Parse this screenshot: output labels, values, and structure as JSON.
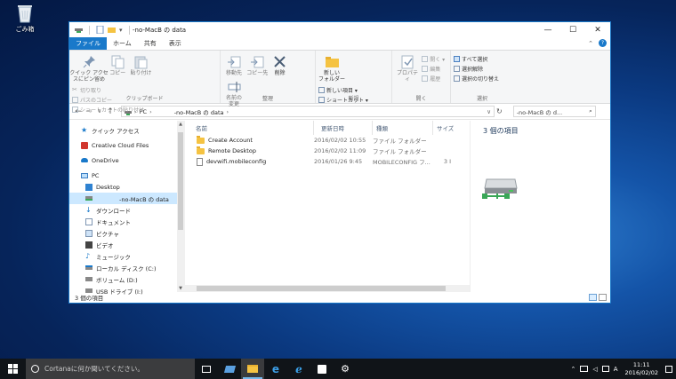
{
  "desktop": {
    "recycle_bin_label": "ごみ箱"
  },
  "window": {
    "title": "-no-MacB の data",
    "controls": {
      "minimize": "—",
      "maximize": "☐",
      "close": "✕"
    },
    "tabs": [
      {
        "label": "ファイル"
      },
      {
        "label": "ホーム"
      },
      {
        "label": "共有"
      },
      {
        "label": "表示"
      }
    ],
    "ribbon": {
      "clipboard": {
        "group_name": "クリップボード",
        "pin_label": "クイック アクセ\nスにピン留め",
        "copy_label": "コピー",
        "paste_label": "貼り付け",
        "cut_label": "切り取り",
        "copy_path_label": "パスのコピー",
        "paste_shortcut_label": "ショートカットの貼り付け"
      },
      "organize": {
        "group_name": "整理",
        "move_label": "移動先",
        "copyto_label": "コピー先",
        "delete_label": "削除",
        "rename_label": "名前の\n変更"
      },
      "new": {
        "group_name": "新規",
        "new_folder_label": "新しい\nフォルダー",
        "new_item_label": "新しい項目 ▾",
        "shortcut_label": "ショートカット ▾"
      },
      "open": {
        "group_name": "開く",
        "properties_label": "プロパティ",
        "open_label": "開く ▾",
        "edit_label": "編集",
        "history_label": "履歴"
      },
      "select": {
        "group_name": "選択",
        "select_all_label": "すべて選択",
        "select_none_label": "選択解除",
        "invert_label": "選択の切り替え"
      }
    },
    "address": {
      "path": [
        "PC",
        "-no-MacB の data"
      ],
      "search_placeholder": "-no-MacB の d..."
    },
    "nav": [
      {
        "label": "クイック アクセス"
      },
      {
        "label": "Creative Cloud Files"
      },
      {
        "label": "OneDrive"
      },
      {
        "label": "PC"
      },
      {
        "label": "Desktop"
      },
      {
        "label": "-no-MacB の data"
      },
      {
        "label": "ダウンロード"
      },
      {
        "label": "ドキュメント"
      },
      {
        "label": "ピクチャ"
      },
      {
        "label": "ビデオ"
      },
      {
        "label": "ミュージック"
      },
      {
        "label": "ローカル ディスク (C:)"
      },
      {
        "label": "ボリューム (D:)"
      },
      {
        "label": "USB ドライブ (I:)"
      }
    ],
    "columns": {
      "name": "名前",
      "date": "更新日時",
      "type": "種類",
      "size": "サイズ"
    },
    "files": [
      {
        "name": "Create Account",
        "date": "2016/02/02 10:55",
        "type": "ファイル フォルダー",
        "size": ""
      },
      {
        "name": "Remote Desktop",
        "date": "2016/02/02 11:09",
        "type": "ファイル フォルダー",
        "size": ""
      },
      {
        "name": "devwifi.mobileconfig",
        "date": "2016/01/26 9:45",
        "type": "MOBILECONFIG フ...",
        "size": "3 I"
      }
    ],
    "preview": {
      "count": "3 個の項目"
    },
    "status": {
      "count": "3 個の項目"
    }
  },
  "taskbar": {
    "cortana_placeholder": "Cortanaに何か聞いてください。",
    "ime": "A",
    "time": "11:11",
    "date": "2016/02/02"
  },
  "colors": {
    "accent": "#1979ca",
    "taskbar": "#101418",
    "selection": "#cce8ff"
  }
}
